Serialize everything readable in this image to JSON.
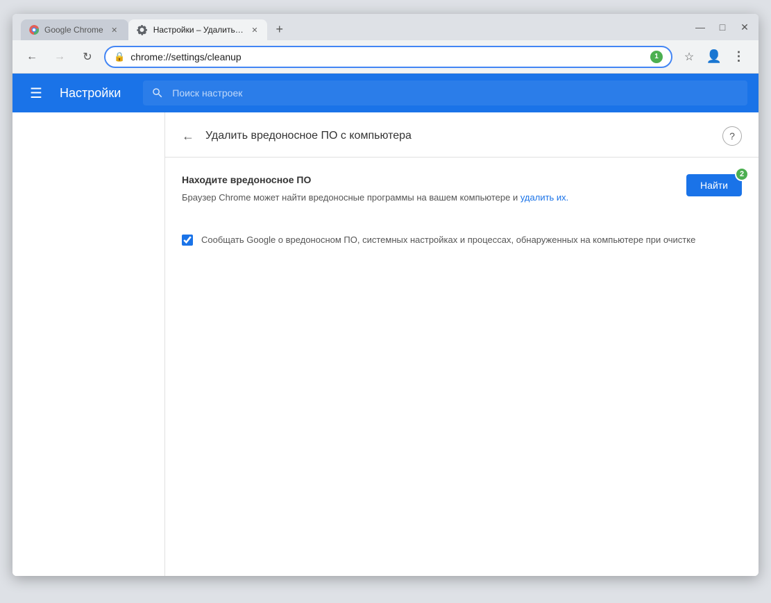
{
  "window": {
    "title": "Google Chrome",
    "controls": {
      "minimize": "—",
      "maximize": "□",
      "close": "✕"
    }
  },
  "tabs": [
    {
      "id": "tab-google-chrome",
      "label": "Google Chrome",
      "icon": "chrome",
      "active": false
    },
    {
      "id": "tab-settings",
      "label": "Настройки – Удалить вредонос...",
      "icon": "gear",
      "active": true
    }
  ],
  "new_tab_label": "+",
  "navbar": {
    "back_title": "Назад",
    "forward_title": "Вперёд",
    "refresh_title": "Обновить",
    "address": "chrome://settings/cleanup",
    "step_badge": "1",
    "bookmark_title": "Добавить в закладки",
    "account_title": "Аккаунт",
    "menu_title": "Настройка и управление Google Chrome"
  },
  "header": {
    "menu_label": "≡",
    "title": "Настройки",
    "search_placeholder": "Поиск настроек"
  },
  "panel": {
    "back_label": "←",
    "title": "Удалить вредоносное ПО с компьютера",
    "help_label": "?"
  },
  "section": {
    "title": "Находите вредоносное ПО",
    "desc_part1": "Браузер Chrome может найти вредоносные программы на вашем компьютере и",
    "desc_link": " удалить их.",
    "find_btn_label": "Найти",
    "step_badge": "2",
    "checkbox_checked": true,
    "checkbox_label": "Сообщать Google о вредоносном ПО, системных настройках и процессах, обнаруженных на компьютере при очистке"
  }
}
